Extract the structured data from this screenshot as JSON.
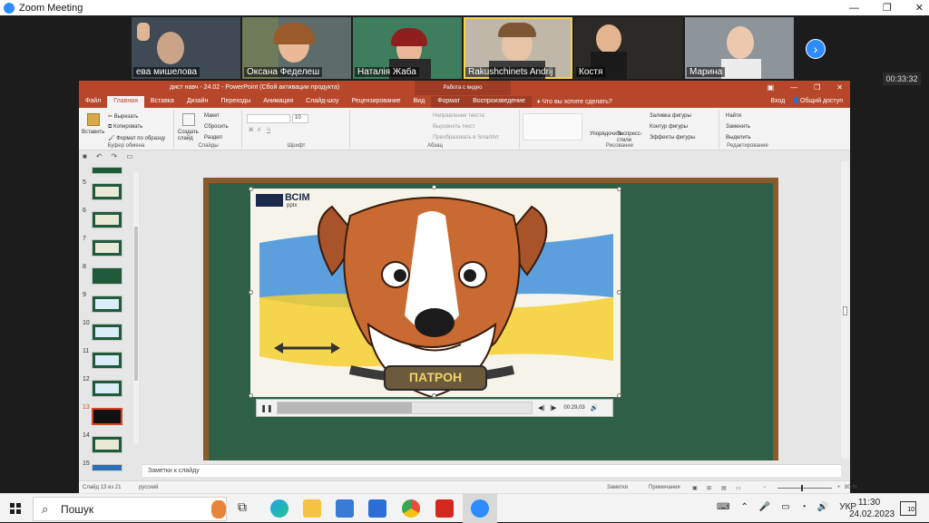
{
  "window": {
    "title": "Zoom Meeting",
    "controls": [
      "—",
      "❐",
      "✕"
    ]
  },
  "gallery": [
    {
      "name": "ева мишелова"
    },
    {
      "name": "Оксана Феделеш"
    },
    {
      "name": "Наталія Жаба"
    },
    {
      "name": "Rakushchinets Andrij"
    },
    {
      "name": "Костя"
    },
    {
      "name": "Марина"
    }
  ],
  "meeting_timer": "00:33:32",
  "ppt": {
    "title": "дист навч - 24.02 - PowerPoint (Сбой активации продукта)",
    "context_tab_group": "Работа с видео",
    "tabs": [
      "Файл",
      "Главная",
      "Вставка",
      "Дизайн",
      "Переходы",
      "Анимация",
      "Слайд-шоу",
      "Рецензирование",
      "Вид",
      "Формат",
      "Воспроизведение"
    ],
    "tell_me": "Что вы хотите сделать?",
    "sign_in": "Вход",
    "share": "Общий доступ",
    "ribbon": {
      "paste": "Вставить",
      "cut": "Вырезать",
      "copy": "Копировать",
      "format_painter": "Формат по образцу",
      "clipboard": "Буфер обмена",
      "new_slide": "Создать слайд",
      "layout": "Макет",
      "reset": "Сбросить",
      "section": "Раздел",
      "slides": "Слайды",
      "font": "Шрифт",
      "font_size": "10",
      "bold": "Ж",
      "italic": "К",
      "underline": "Ч",
      "text_direction": "Направление текста",
      "align_text": "Выровнять текст",
      "smartart": "Преобразовать в SmartArt",
      "paragraph": "Абзац",
      "arrange": "Упорядочить",
      "quick_styles": "Экспресс-стили",
      "shape_fill": "Заливка фигуры",
      "shape_outline": "Контур фигуры",
      "shape_effects": "Эффекты фигуры",
      "drawing": "Рисование",
      "find": "Найти",
      "replace": "Заменить",
      "select": "Выделить",
      "editing": "Редактирование"
    },
    "thumbnails": [
      "5",
      "6",
      "7",
      "8",
      "9",
      "10",
      "11",
      "12",
      "13",
      "14",
      "15"
    ],
    "selected_slide": "13",
    "slide": {
      "brand": "ВСІМ",
      "brand_sub": "pptx",
      "badge": "ПАТРОН",
      "player_time": "00:29,03",
      "progress": 0.53
    },
    "notes_placeholder": "Заметки к слайду",
    "status": {
      "slide_of": "Слайд 13 из 21",
      "lang": "русский",
      "notes": "Заметки",
      "comments": "Примечания",
      "zoom": "80 %"
    }
  },
  "taskbar": {
    "search": "Пошук",
    "lang": "УКР",
    "time": "11:30",
    "date": "24.02.2023",
    "notif_count": "10"
  }
}
